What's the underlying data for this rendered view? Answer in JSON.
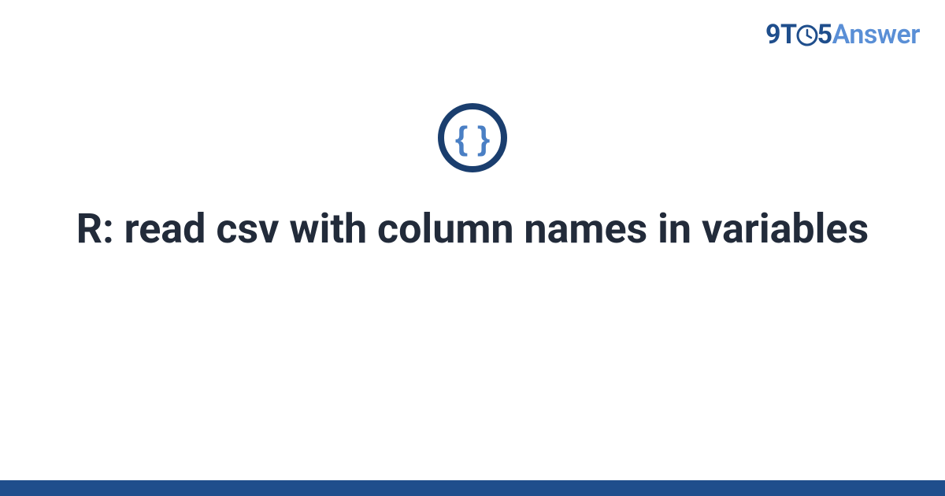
{
  "brand": {
    "part1": "9T",
    "part2": "5",
    "part3": "Answer"
  },
  "title": "R: read csv with column names in variables",
  "colors": {
    "brand_primary": "#1f4e8c",
    "brand_secondary": "#5a8fd6",
    "icon_inner": "#4a7fc4",
    "icon_outer": "#1a3e6e",
    "title_color": "#222b3a",
    "footer": "#1f4e8c"
  }
}
